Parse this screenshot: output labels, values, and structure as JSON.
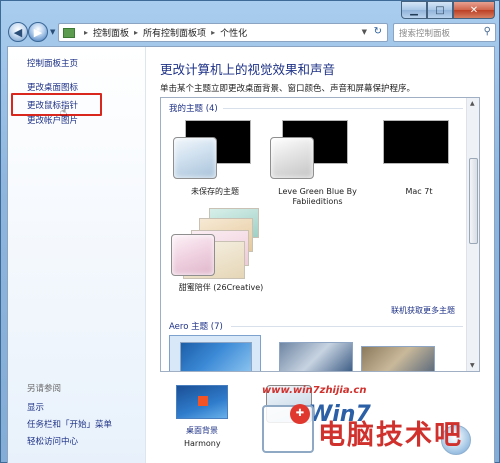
{
  "window": {
    "minimize_label": "▁",
    "maximize_label": "□",
    "close_label": "✕"
  },
  "nav": {
    "back_label": "◀",
    "forward_label": "▶",
    "breadcrumb": [
      "控制面板",
      "所有控制面板项",
      "个性化"
    ],
    "separator": "▸",
    "search_placeholder": "搜索控制面板",
    "refresh_label": "↻"
  },
  "sidebar": {
    "items": [
      {
        "label": "控制面板主页"
      },
      {
        "label": "更改桌面图标"
      },
      {
        "label": "更改鼠标指针"
      },
      {
        "label": "更改帐户图片"
      }
    ],
    "see_also_title": "另请参阅",
    "see_also": [
      {
        "label": "显示"
      },
      {
        "label": "任务栏和「开始」菜单"
      },
      {
        "label": "轻松访问中心"
      }
    ]
  },
  "main": {
    "title": "更改计算机上的视觉效果和声音",
    "description": "单击某个主题立即更改桌面背景、窗口颜色、声音和屏幕保护程序。"
  },
  "my_themes": {
    "label": "我的主题 (4)",
    "items": [
      {
        "name": "未保存的主题"
      },
      {
        "name": "Leve Green Blue By",
        "name2": "Fabiieditions"
      },
      {
        "name": "Mac 7t"
      },
      {
        "name": "甜蜜陪伴 (26Creative)"
      }
    ],
    "more_link": "联机获取更多主题"
  },
  "aero_themes": {
    "label": "Aero 主题 (7)"
  },
  "bottom": {
    "desktop_background_label": "桌面背景",
    "desktop_background_value": "Harmony"
  },
  "watermark": {
    "url": "www.win7zhijia.cn",
    "text": "电脑技术吧"
  },
  "colors": {
    "link": "#1e3287",
    "highlight": "#d9271e",
    "watermark": "#d0312d"
  }
}
